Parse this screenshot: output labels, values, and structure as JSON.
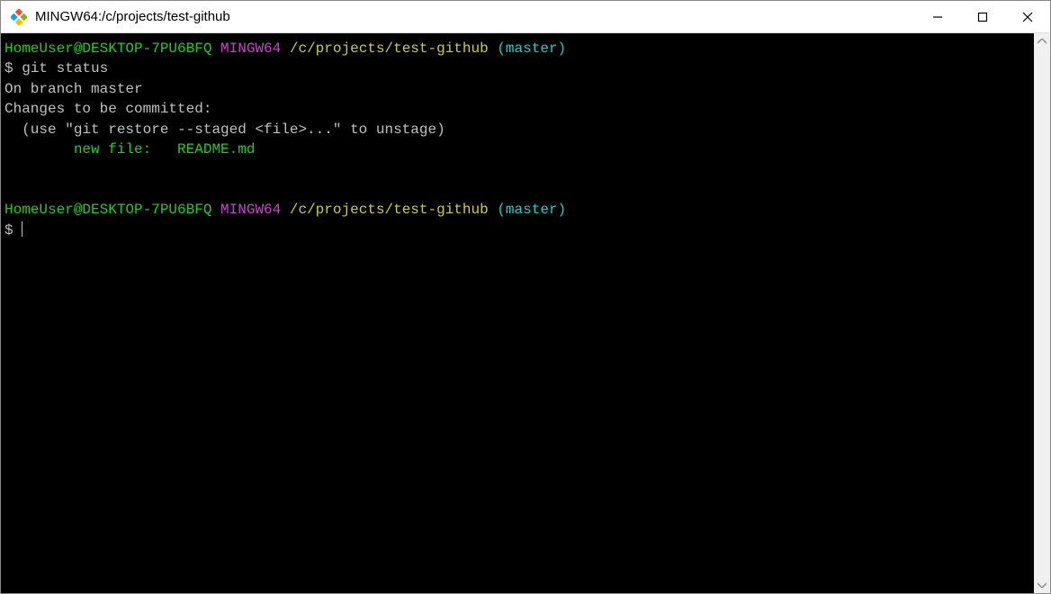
{
  "titlebar": {
    "title": "MINGW64:/c/projects/test-github"
  },
  "prompt1": {
    "user_host": "HomeUser@DESKTOP-7PU6BFQ",
    "env": "MINGW64",
    "path": "/c/projects/test-github",
    "branch": "(master)",
    "dollar": "$",
    "command": "git status"
  },
  "output": {
    "line1": "On branch master",
    "line2": "Changes to be committed:",
    "line3": "  (use \"git restore --staged <file>...\" to unstage)",
    "line4_label": "        new file:   ",
    "line4_file": "README.md"
  },
  "prompt2": {
    "user_host": "HomeUser@DESKTOP-7PU6BFQ",
    "env": "MINGW64",
    "path": "/c/projects/test-github",
    "branch": "(master)",
    "dollar": "$"
  }
}
